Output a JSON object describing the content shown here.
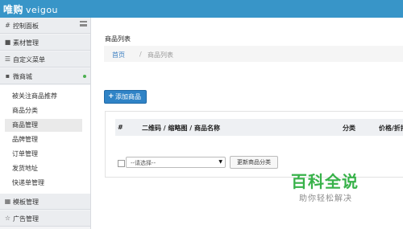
{
  "brand": {
    "name": "唯购",
    "sub": "veigou"
  },
  "sidebar": {
    "items": [
      {
        "icon": "#",
        "label": "控制面板"
      },
      {
        "icon": "■",
        "label": "素材管理"
      },
      {
        "icon": "☰",
        "label": "自定义菜单"
      },
      {
        "icon": "▪",
        "label": "微商城"
      }
    ],
    "submenu": [
      "被关注商品推荐",
      "商品分类",
      "商品管理",
      "品牌管理",
      "订单管理",
      "发货地址",
      "快递单管理"
    ],
    "bottom": [
      {
        "icon": "▦",
        "label": "模板管理"
      },
      {
        "icon": "☆",
        "label": "广告管理"
      }
    ],
    "status_color": "#4caf50"
  },
  "main": {
    "title": "商品列表",
    "breadcrumb": {
      "home": "首页",
      "sep": "/",
      "current": "商品列表"
    },
    "add_button": {
      "icon": "+",
      "label": "添加商品"
    },
    "table": {
      "headers": [
        "#",
        "二维码 / 缩略图 / 商品名称",
        "分类",
        "价格/折扣"
      ]
    },
    "select": {
      "value": "--请选择--"
    },
    "update_button": "更新商品分类"
  },
  "watermark": {
    "title": "百科全说",
    "sub": "助你轻松解决"
  },
  "colors": {
    "topbar": "#3895c8",
    "accent": "#2f83c6",
    "watermark": "#38b24a"
  }
}
